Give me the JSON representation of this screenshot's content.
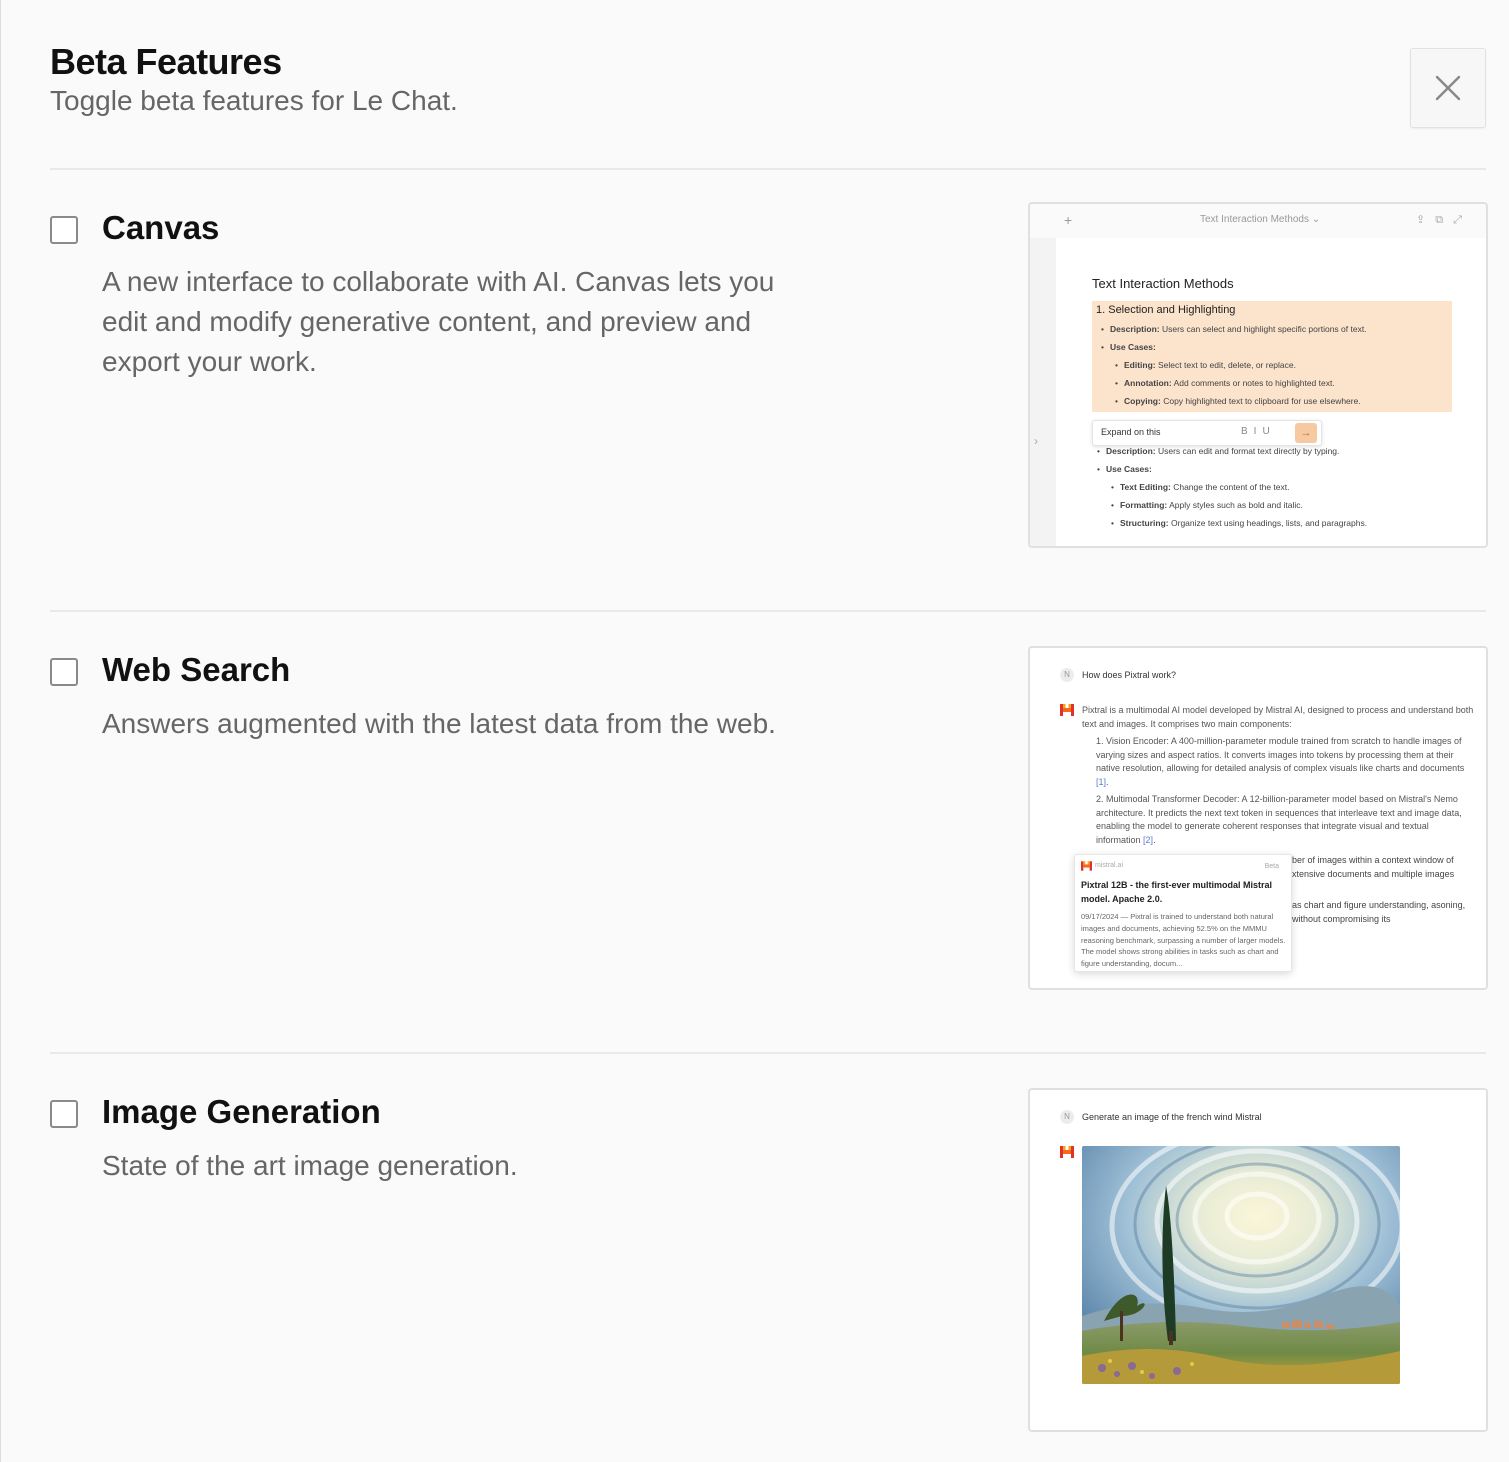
{
  "header": {
    "title": "Beta Features",
    "subtitle": "Toggle beta features for Le Chat."
  },
  "close_icon": "close-icon",
  "features": [
    {
      "title": "Canvas",
      "description": "A new interface to collaborate with AI. Canvas lets you edit and modify generative content, and preview and export your work.",
      "enabled": false,
      "preview": {
        "tab_title": "Text Interaction Methods",
        "doc_title": "Text Interaction Methods",
        "section1": "1. Selection and Highlighting",
        "items": [
          {
            "label": "Description:",
            "text": "Users can select and highlight specific portions of text."
          },
          {
            "label": "Use Cases:",
            "text": ""
          },
          {
            "label": "Editing:",
            "text": "Select text to edit, delete, or replace."
          },
          {
            "label": "Annotation:",
            "text": "Add comments or notes to highlighted text."
          },
          {
            "label": "Copying:",
            "text": "Copy highlighted text to clipboard for use elsewhere."
          }
        ],
        "toolbar_text": "Expand on this",
        "items2": [
          {
            "label": "Description:",
            "text": "Users can edit and format text directly by typing."
          },
          {
            "label": "Use Cases:",
            "text": ""
          },
          {
            "label": "Text Editing:",
            "text": "Change the content of the text."
          },
          {
            "label": "Formatting:",
            "text": "Apply styles such as bold and italic."
          },
          {
            "label": "Structuring:",
            "text": "Organize text using headings, lists, and paragraphs."
          }
        ]
      }
    },
    {
      "title": "Web Search",
      "description": "Answers augmented with the latest data from the web.",
      "enabled": false,
      "preview": {
        "avatar": "N",
        "question": "How does Pixtral work?",
        "intro": "Pixtral is a multimodal AI model developed by Mistral AI, designed to process and understand both text and images. It comprises two main components:",
        "point1": "1. Vision Encoder: A 400-million-parameter module trained from scratch to handle images of varying sizes and aspect ratios. It converts images into tokens by processing them at their native resolution, allowing for detailed analysis of complex visuals like charts and documents",
        "cite1": "[1]",
        "point2": "2. Multimodal Transformer Decoder: A 12-billion-parameter model based on Mistral's Nemo architecture. It predicts the next text token in sequences that interleave text and image data, enabling the model to generate coherent responses that integrate visual and textual information",
        "cite2": "[2]",
        "tail1": "ber of images within a context window of xtensive documents and multiple images",
        "tail2": "as chart and figure understanding, asoning, without compromising its",
        "popup_source": "mistral.ai",
        "popup_badge": "Beta",
        "popup_title": "Pixtral 12B - the first-ever multimodal Mistral model. Apache 2.0.",
        "popup_desc": "09/17/2024 — Pixtral is trained to understand both natural images and documents, achieving 52.5% on the MMMU reasoning benchmark, surpassing a number of larger models. The model shows strong abilities in tasks such as chart and figure understanding, docum..."
      }
    },
    {
      "title": "Image Generation",
      "description": "State of the art image generation.",
      "enabled": false,
      "preview": {
        "avatar": "N",
        "question": "Generate an image of the french wind Mistral"
      }
    }
  ]
}
